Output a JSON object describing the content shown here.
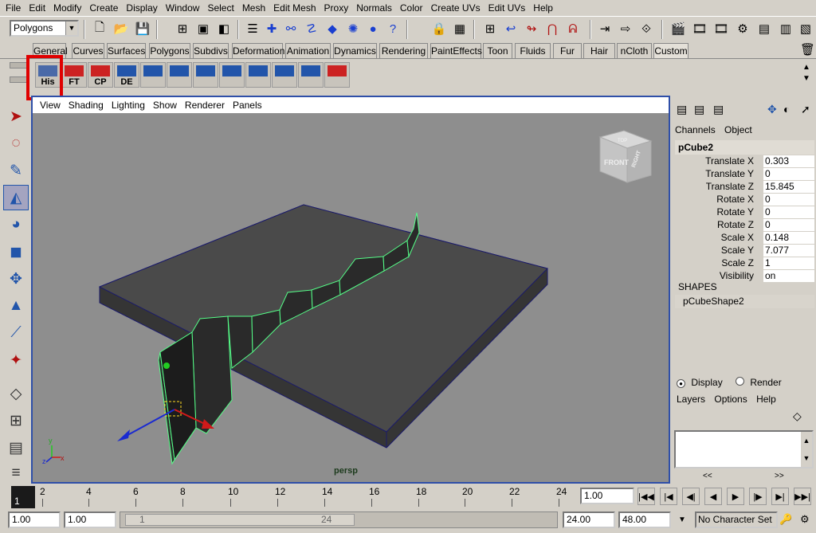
{
  "menubar": {
    "items": [
      "File",
      "Edit",
      "Modify",
      "Create",
      "Display",
      "Window",
      "Select",
      "Mesh",
      "Edit Mesh",
      "Proxy",
      "Normals",
      "Color",
      "Create UVs",
      "Edit UVs",
      "Help"
    ]
  },
  "statusline": {
    "mode": "Polygons"
  },
  "shelf": {
    "tabs": [
      "General",
      "Curves",
      "Surfaces",
      "Polygons",
      "Subdivs",
      "Deformation",
      "Animation",
      "Dynamics",
      "Rendering",
      "PaintEffects",
      "Toon",
      "Fluids",
      "Fur",
      "Hair",
      "nCloth",
      "Custom"
    ],
    "active_tab": "Custom",
    "buttons": [
      {
        "label": "His",
        "icon": "history-icon",
        "color": "#4a6aa8"
      },
      {
        "label": "FT",
        "icon": "freeze-transform-icon",
        "color": "#cc2222"
      },
      {
        "label": "CP",
        "icon": "center-pivot-icon",
        "color": "#cc2222"
      },
      {
        "label": "DE",
        "icon": "delete-history-icon",
        "color": "#2255aa"
      },
      {
        "label": "",
        "icon": "uv-layout-icon",
        "color": "#2255aa"
      },
      {
        "label": "",
        "icon": "select-uv-icon",
        "color": "#2255aa"
      },
      {
        "label": "",
        "icon": "planar-map-icon",
        "color": "#2255aa"
      },
      {
        "label": "",
        "icon": "sphere-map-icon",
        "color": "#2255aa"
      },
      {
        "label": "",
        "icon": "uv-editor-icon",
        "color": "#2255aa"
      },
      {
        "label": "",
        "icon": "uv-shell-icon",
        "color": "#2255aa"
      },
      {
        "label": "",
        "icon": "cut-uv-icon",
        "color": "#2255aa"
      },
      {
        "label": "",
        "icon": "sew-uv-icon",
        "color": "#cc2222"
      }
    ]
  },
  "viewport": {
    "menus": [
      "View",
      "Shading",
      "Lighting",
      "Show",
      "Renderer",
      "Panels"
    ],
    "camera_label": "persp",
    "viewcube_front": "FRONT",
    "viewcube_right": "RIGHT",
    "viewcube_top": "TOP",
    "axis_x": "x",
    "axis_y": "y",
    "axis_z": "z",
    "colors": {
      "background": "#8e8e8e",
      "platform": "#4a4a4a",
      "wall": "#222222",
      "wire": "#55ff88",
      "edge": "#1a1a6a"
    }
  },
  "channelbox": {
    "tabs": [
      "Channels",
      "Object"
    ],
    "object": "pCube2",
    "attributes": [
      {
        "name": "Translate X",
        "value": "0.303"
      },
      {
        "name": "Translate Y",
        "value": "0"
      },
      {
        "name": "Translate Z",
        "value": "15.845"
      },
      {
        "name": "Rotate X",
        "value": "0"
      },
      {
        "name": "Rotate Y",
        "value": "0"
      },
      {
        "name": "Rotate Z",
        "value": "0"
      },
      {
        "name": "Scale X",
        "value": "0.148"
      },
      {
        "name": "Scale Y",
        "value": "7.077"
      },
      {
        "name": "Scale Z",
        "value": "1"
      },
      {
        "name": "Visibility",
        "value": "on"
      }
    ],
    "shapes_header": "SHAPES",
    "shape_name": "pCubeShape2"
  },
  "layers": {
    "display_label": "Display",
    "render_label": "Render",
    "menus": [
      "Layers",
      "Options",
      "Help"
    ],
    "nav_left": "<<",
    "nav_right": ">>"
  },
  "timeline": {
    "current_frame": "1",
    "ticks": [
      "2",
      "4",
      "6",
      "8",
      "10",
      "12",
      "14",
      "16",
      "18",
      "20",
      "22",
      "24"
    ],
    "current_time": "1.00"
  },
  "range": {
    "start_time": "1.00",
    "playback_start": "1.00",
    "range_start_label": "1",
    "range_end_label": "24",
    "playback_end": "24.00",
    "end_time": "48.00",
    "character_set": "No Character Set"
  }
}
